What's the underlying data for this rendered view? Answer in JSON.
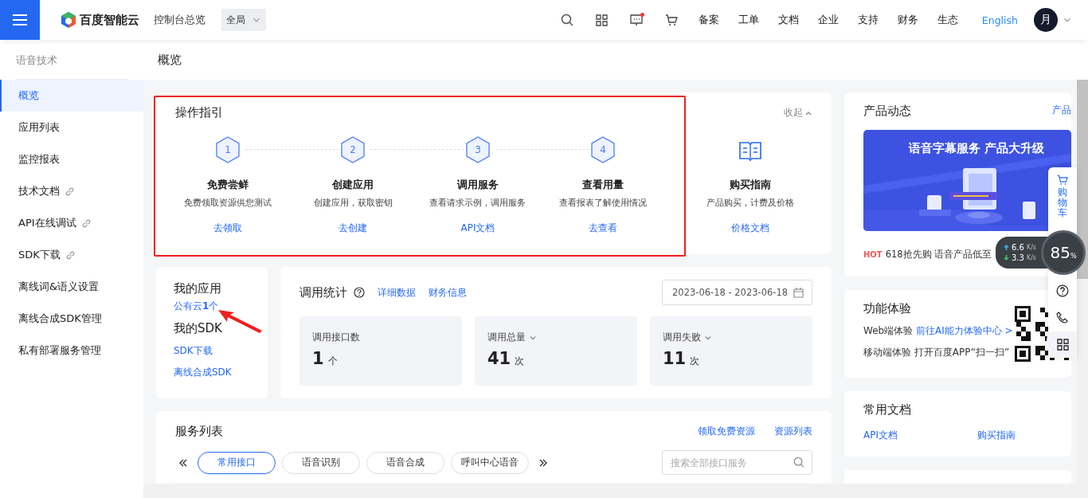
{
  "topbar": {
    "brand": "百度智能云",
    "console": "控制台总览",
    "region": "全局",
    "nav": [
      "备案",
      "工单",
      "文档",
      "企业",
      "支持",
      "财务",
      "生态"
    ],
    "language": "English",
    "avatar": "月",
    "message_unread": true
  },
  "sidebar": {
    "title": "语音技术",
    "items": [
      {
        "label": "概览",
        "selected": true,
        "external": false
      },
      {
        "label": "应用列表",
        "selected": false,
        "external": false
      },
      {
        "label": "监控报表",
        "selected": false,
        "external": false
      },
      {
        "label": "技术文档",
        "selected": false,
        "external": true
      },
      {
        "label": "API在线调试",
        "selected": false,
        "external": true
      },
      {
        "label": "SDK下载",
        "selected": false,
        "external": true
      },
      {
        "label": "离线词&语义设置",
        "selected": false,
        "external": false
      },
      {
        "label": "离线合成SDK管理",
        "selected": false,
        "external": false
      },
      {
        "label": "私有部署服务管理",
        "selected": false,
        "external": false
      }
    ]
  },
  "page_title": "概览",
  "guide": {
    "title": "操作指引",
    "collapse": "收起",
    "highlighted": true,
    "steps": [
      {
        "kind": "step",
        "number": "1",
        "title": "免费尝鲜",
        "desc": "免费领取资源供您测试",
        "link": "去领取"
      },
      {
        "kind": "step",
        "number": "2",
        "title": "创建应用",
        "desc": "创建应用，获取密钥",
        "link": "去创建"
      },
      {
        "kind": "step",
        "number": "3",
        "title": "调用服务",
        "desc": "查看请求示例，调用服务",
        "link": "API文档"
      },
      {
        "kind": "step",
        "number": "4",
        "title": "查看用量",
        "desc": "查看报表了解使用情况",
        "link": "去查看"
      },
      {
        "kind": "book",
        "title": "购买指南",
        "desc": "产品购买，计费及价格",
        "link": "价格文档"
      }
    ]
  },
  "my_apps": {
    "title": "我的应用",
    "app_link": "公有云**1**个",
    "sdk_title": "我的SDK",
    "sdk_links": [
      "SDK下载",
      "离线合成SDK"
    ],
    "arrow": true
  },
  "stats": {
    "title": "调用统计",
    "links": [
      "详细数据",
      "财务信息"
    ],
    "date_range": "2023-06-18 - 2023-06-18",
    "tiles": [
      {
        "label": "调用接口数",
        "value": "1",
        "unit": "个",
        "dropdown": false
      },
      {
        "label": "调用总量",
        "value": "41",
        "unit": "次",
        "dropdown": true
      },
      {
        "label": "调用失败",
        "value": "11",
        "unit": "次",
        "dropdown": true
      }
    ]
  },
  "services": {
    "title": "服务列表",
    "links": [
      "领取免费资源",
      "资源列表"
    ],
    "tabs": [
      {
        "label": "常用接口",
        "selected": true
      },
      {
        "label": "语音识别",
        "selected": false
      },
      {
        "label": "语音合成",
        "selected": false
      },
      {
        "label": "呼叫中心语音",
        "selected": false
      }
    ],
    "search": {
      "placeholder": "搜索全部接口服务"
    }
  },
  "news": {
    "title": "产品动态",
    "more": "产品",
    "banner": {
      "kind": "picture",
      "headline": "语音字幕服务 产品大升级"
    },
    "badge": "HOT",
    "item": "618抢先购 语音产品低至"
  },
  "experience": {
    "title": "功能体验",
    "rows": [
      {
        "label": "Web端体验",
        "link": "前往AI能力体验中心 >"
      },
      {
        "label": "移动端体验 打开百度APP“扫一扫”"
      }
    ]
  },
  "docs": {
    "title": "常用文档",
    "links": [
      "API文档",
      "购买指南"
    ]
  },
  "float_bar": {
    "cart": "购物车"
  },
  "speed_widget": {
    "up": "6.6",
    "up_unit": "K/s",
    "down": "3.3",
    "down_unit": "K/s",
    "percent": "85",
    "percent_sign": "%"
  }
}
